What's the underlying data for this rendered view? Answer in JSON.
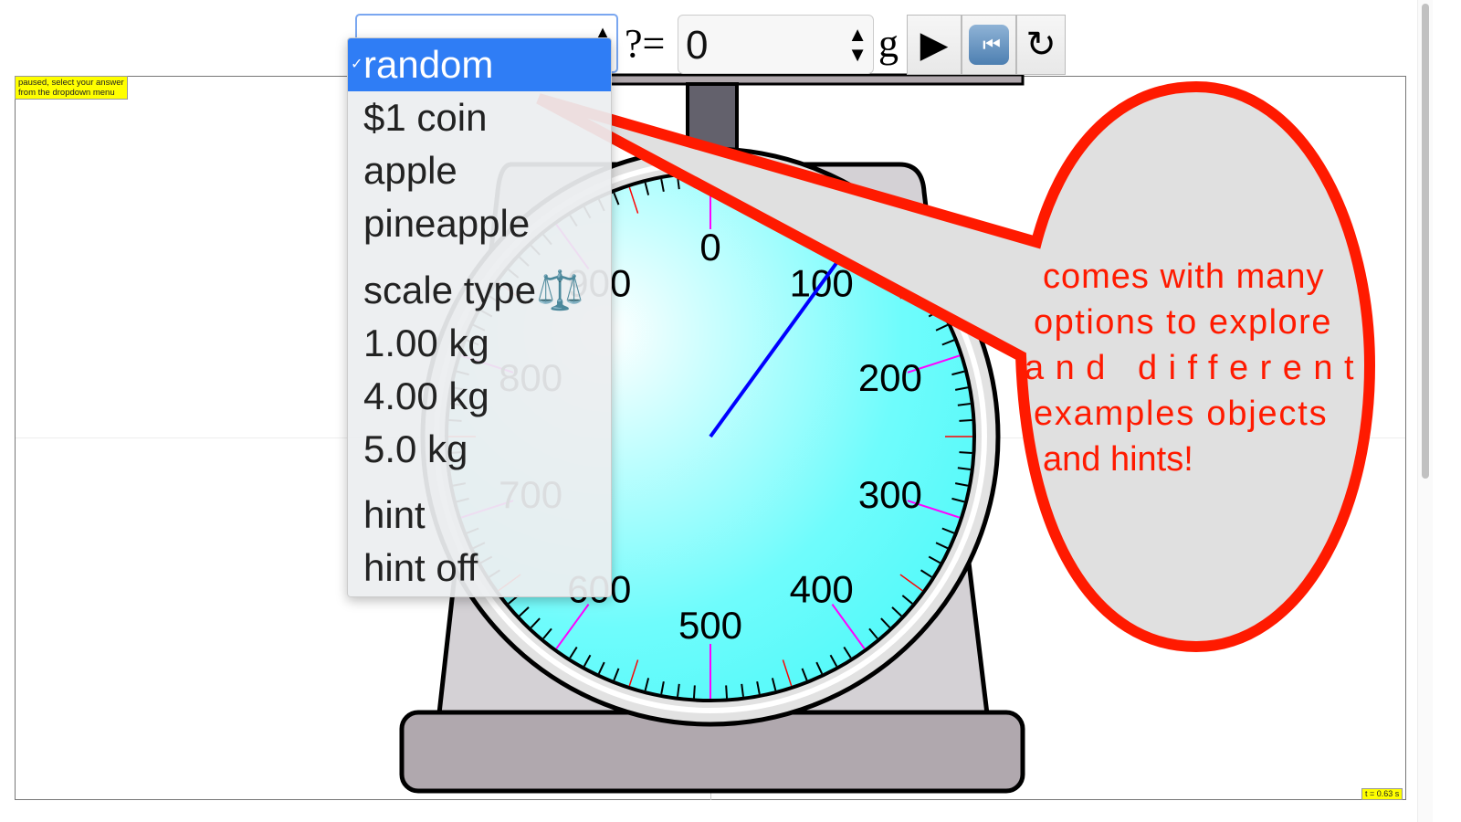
{
  "status": {
    "message_line1": "paused, select your answer",
    "message_line2": "from the dropdown menu"
  },
  "timer": {
    "label": "t = 0.63 s"
  },
  "toolbar": {
    "object_select": {
      "selected": "random"
    },
    "question_label": "?=",
    "answer_value": "0",
    "unit_label": "g",
    "play_icon": "play-icon",
    "rewind_icon": "rewind-icon",
    "reset_icon": "reset-icon"
  },
  "dropdown": {
    "options": [
      {
        "label": "random",
        "selected": true
      },
      {
        "label": "$1 coin"
      },
      {
        "label": "apple"
      },
      {
        "label": "pineapple"
      },
      {
        "label": "scale type⚖️",
        "group_header": true
      },
      {
        "label": "1.00 kg"
      },
      {
        "label": "4.00 kg"
      },
      {
        "label": "5.0 kg"
      },
      {
        "label": "hint"
      },
      {
        "label": "hint off"
      }
    ]
  },
  "dial": {
    "labels": [
      "0",
      "100",
      "200",
      "300",
      "400",
      "500",
      "600",
      "700",
      "800",
      "900"
    ],
    "max_value": 1000,
    "unit": "g",
    "needle_reading": 100,
    "colors": {
      "face": "#5ffcfc",
      "needle": "#0000ff",
      "major_tick": "#ff00ff",
      "mid_tick": "#ff0000"
    }
  },
  "callout": {
    "lines": [
      "comes with many",
      "options to explore",
      "and different",
      "examples objects",
      "and hints!"
    ],
    "color": "#ff1a00"
  }
}
